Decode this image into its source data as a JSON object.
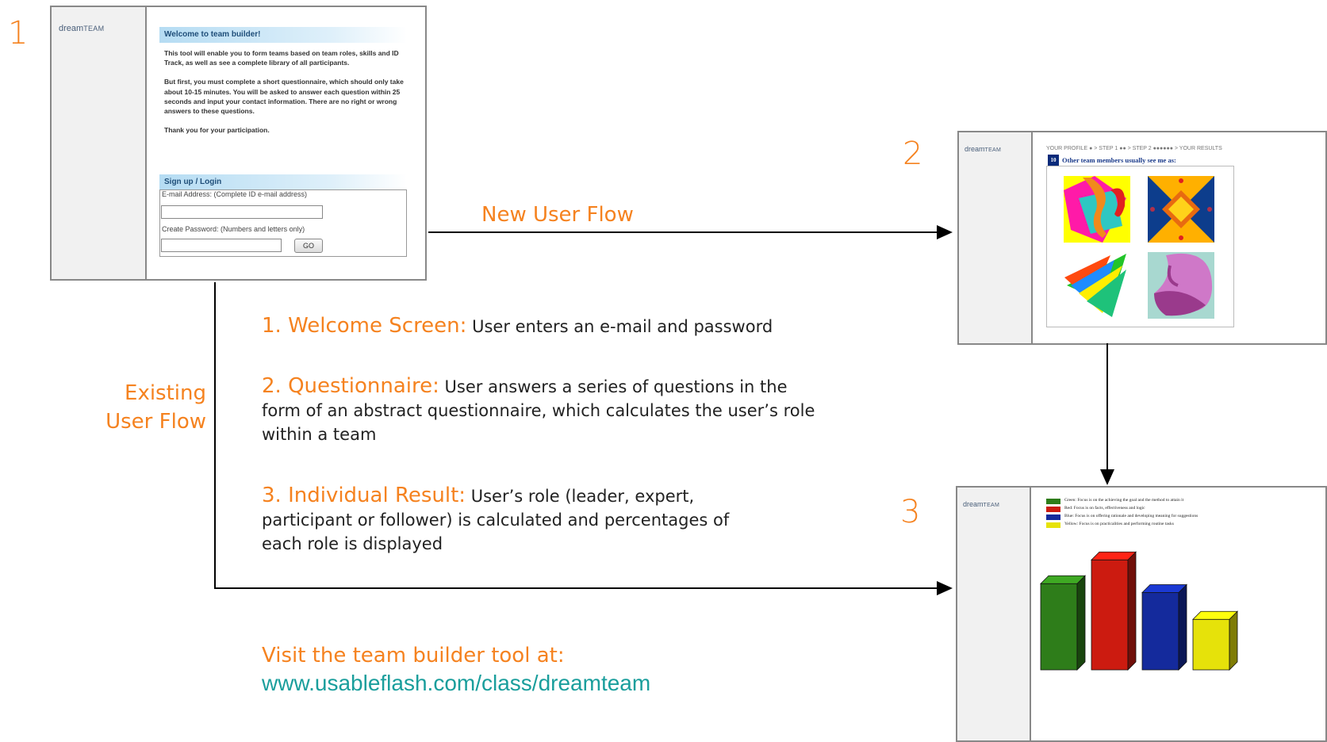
{
  "steps": {
    "one": "1",
    "two": "2",
    "three": "3"
  },
  "screen1": {
    "logo_main": "dream",
    "logo_suffix": "TEAM",
    "welcome_title": "Welcome to team builder!",
    "paragraphs": [
      "This tool will enable you to  form teams based on team roles, skills and ID Track, as well as see a complete library of all participants.",
      "But first, you must complete a short questionnaire, which should only take about 10-15 minutes.  You will be asked to answer each question within 25 seconds and input your contact information. There are no right or wrong answers to these questions.",
      "Thank you for your participation."
    ],
    "login_title": "Sign up / Login",
    "email_label": "E-mail Address: (Complete ID e-mail address)",
    "password_label": "Create Password: (Numbers and letters only)",
    "go_label": "GO"
  },
  "screen2": {
    "logo_main": "dream",
    "logo_suffix": "TEAM",
    "breadcrumb": "YOUR PROFILE ● > STEP 1 ●● > STEP 2 ●●●●●● > YOUR RESULTS",
    "question_number": "10",
    "question_text": "Other team members usually see me as:"
  },
  "screen3": {
    "logo_main": "dream",
    "logo_suffix": "TEAM",
    "legend": [
      {
        "color": "#2e7d1a",
        "text": "Green: Focus is on the achieving the goal and the method to attain it"
      },
      {
        "color": "#cc1b10",
        "text": "Red: Focus is on facts, effectiveness and logic"
      },
      {
        "color": "#142a9c",
        "text": "Blue: Focus is on offering rationale and developing meaning for suggestions"
      },
      {
        "color": "#e6e20a",
        "text": "Yellow: Focus is on practicalities and performing routine tasks"
      }
    ]
  },
  "chart_data": {
    "type": "bar",
    "categories": [
      "Green",
      "Red",
      "Blue",
      "Yellow"
    ],
    "values": [
      29,
      37,
      26,
      17
    ],
    "colors": [
      "#2e7d1a",
      "#cc1b10",
      "#142a9c",
      "#e6e20a"
    ],
    "title": "",
    "xlabel": "",
    "ylabel": "",
    "ylim": [
      0,
      40
    ]
  },
  "flows": {
    "new_user": "New User Flow",
    "existing_user_line1": "Existing",
    "existing_user_line2": "User Flow"
  },
  "descriptions": [
    {
      "heading": "1. Welcome Screen:",
      "body": " User enters an e-mail and password"
    },
    {
      "heading": "2. Questionnaire:",
      "body": " User answers a series of questions in the form of an abstract questionnaire, which calculates the user’s role within a team"
    },
    {
      "heading": "3. Individual Result:",
      "body": " User’s role (leader, expert, participant or follower) is calculated and percentages of each role is displayed"
    }
  ],
  "visit": {
    "label": "Visit the team builder tool at:",
    "url": "www.usableflash.com/class/dreamteam"
  }
}
